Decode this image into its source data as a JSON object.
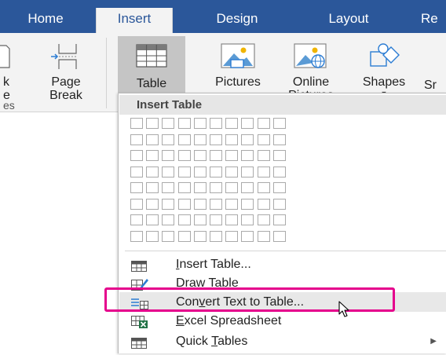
{
  "tabs": [
    {
      "label": "Home",
      "active": false
    },
    {
      "label": "Insert",
      "active": true
    },
    {
      "label": "Design",
      "active": false
    },
    {
      "label": "Layout",
      "active": false
    },
    {
      "label": "Re",
      "active": false
    }
  ],
  "ribbon": {
    "partial_left_label_1": "k",
    "partial_left_label_2": "e",
    "group_label_partial": "es",
    "page_break_line1": "Page",
    "page_break_line2": "Break",
    "table_label": "Table",
    "pictures_label": "Pictures",
    "online_pictures_line1": "Online",
    "online_pictures_line2": "Pictures",
    "shapes_label": "Shapes",
    "next_partial": "Sr"
  },
  "menu": {
    "header": "Insert Table",
    "grid": {
      "columns": 10,
      "rows": 8
    },
    "items": [
      {
        "pre": "",
        "accel": "I",
        "post": "nsert Table...",
        "icon": "insert-table-icon"
      },
      {
        "pre": "",
        "accel": "D",
        "post": "raw Table",
        "icon": "draw-table-icon"
      },
      {
        "pre": "Con",
        "accel": "v",
        "post": "ert Text to Table...",
        "icon": "convert-text-icon"
      },
      {
        "pre": "",
        "accel": "E",
        "post": "xcel Spreadsheet",
        "icon": "excel-spreadsheet-icon"
      },
      {
        "pre": "Quick ",
        "accel": "T",
        "post": "ables",
        "icon": "quick-tables-icon",
        "submenu": true
      }
    ]
  },
  "colors": {
    "ribbon_blue": "#2b579a",
    "highlight": "#e5008c",
    "excel_green": "#217346"
  }
}
